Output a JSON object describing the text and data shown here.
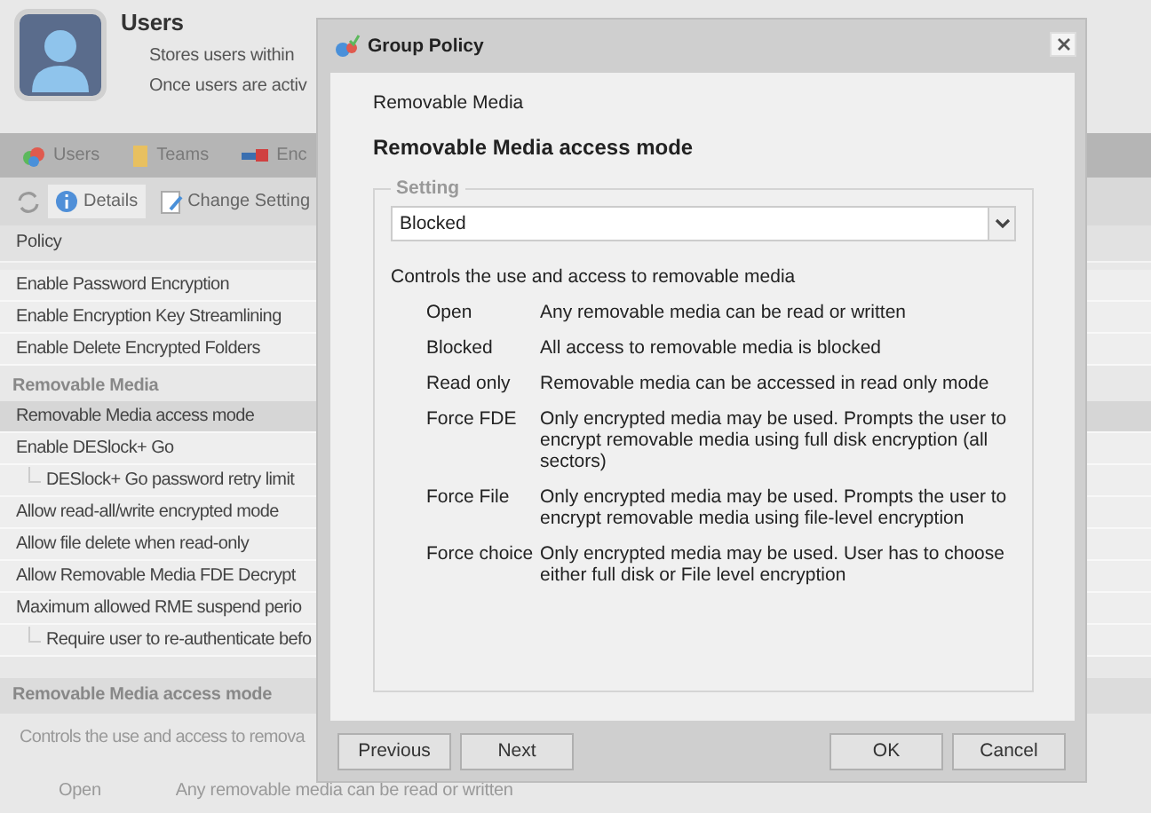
{
  "header": {
    "title": "Users",
    "lines": [
      "Stores users within",
      "Once users are activ"
    ]
  },
  "tabs": [
    {
      "label": "Users"
    },
    {
      "label": "Teams"
    },
    {
      "label": "Enc"
    }
  ],
  "toolbar": {
    "details": "Details",
    "change": "Change Setting"
  },
  "policy_list": {
    "column": "Policy",
    "groups": [
      {
        "rows": [
          {
            "label": "Enable Password Encryption",
            "selected": false
          },
          {
            "label": "Enable Encryption Key Streamlining",
            "selected": false
          },
          {
            "label": "Enable Delete Encrypted Folders",
            "selected": false
          }
        ]
      },
      {
        "heading": "Removable Media",
        "rows": [
          {
            "label": "Removable Media access mode",
            "selected": true
          },
          {
            "label": "Enable DESlock+ Go",
            "selected": false,
            "children": [
              {
                "label": "DESlock+ Go password retry limit",
                "selected": false
              }
            ]
          },
          {
            "label": "Allow read-all/write encrypted mode",
            "selected": false
          },
          {
            "label": "Allow file delete when read-only",
            "selected": false
          },
          {
            "label": "Allow Removable Media FDE Decrypt",
            "selected": false
          },
          {
            "label": "Maximum allowed RME suspend perio",
            "selected": false,
            "children": [
              {
                "label": "Require user to re-authenticate befo",
                "selected": false
              }
            ]
          }
        ]
      }
    ]
  },
  "detail": {
    "title": "Removable Media access mode",
    "description": "Controls the use and access to remova",
    "option": {
      "name": "Open",
      "text": "Any removable media can be read or written"
    }
  },
  "dialog": {
    "title": "Group Policy",
    "category": "Removable Media",
    "heading": "Removable Media access mode",
    "legend": "Setting",
    "value": "Blocked",
    "description": "Controls the use and access to removable media",
    "options": [
      {
        "name": "Open",
        "text": "Any removable media can be read or written"
      },
      {
        "name": "Blocked",
        "text": "All access to removable media is blocked"
      },
      {
        "name": "Read only",
        "text": "Removable media can be accessed in read only mode"
      },
      {
        "name": "Force FDE",
        "text": "Only encrypted media may be used. Prompts the user to encrypt removable media using full disk encryption (all sectors)"
      },
      {
        "name": "Force File",
        "text": "Only encrypted media may be used. Prompts the user to encrypt removable media using file-level encryption"
      },
      {
        "name": "Force choice",
        "text": "Only encrypted media may be used. User has to choose either full disk or File level encryption"
      }
    ],
    "buttons_left": [
      "Previous",
      "Next"
    ],
    "buttons_right": [
      "OK",
      "Cancel"
    ]
  }
}
